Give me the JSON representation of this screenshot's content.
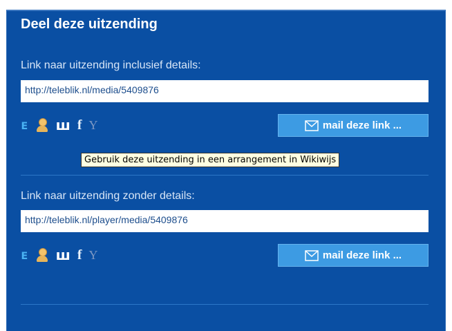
{
  "share": {
    "title": "Deel deze uitzending",
    "section1": {
      "label": "Link naar uitzending inclusief details:",
      "url": "http://teleblik.nl/media/5409876",
      "mail_button": "mail deze link ..."
    },
    "section2": {
      "label": "Link naar uitzending zonder details:",
      "url": "http://teleblik.nl/player/media/5409876",
      "mail_button": "mail deze link ..."
    },
    "tooltip": "Gebruik deze uitzending in een arrangement in Wikiwijs",
    "icons": [
      "twitter-icon",
      "wikiwijs-icon",
      "w-icon",
      "facebook-icon",
      "yahoo-icon"
    ]
  },
  "colors": {
    "panel": "#0a4fa3",
    "button": "#3d9be3",
    "tooltip": "#ffffe1"
  }
}
